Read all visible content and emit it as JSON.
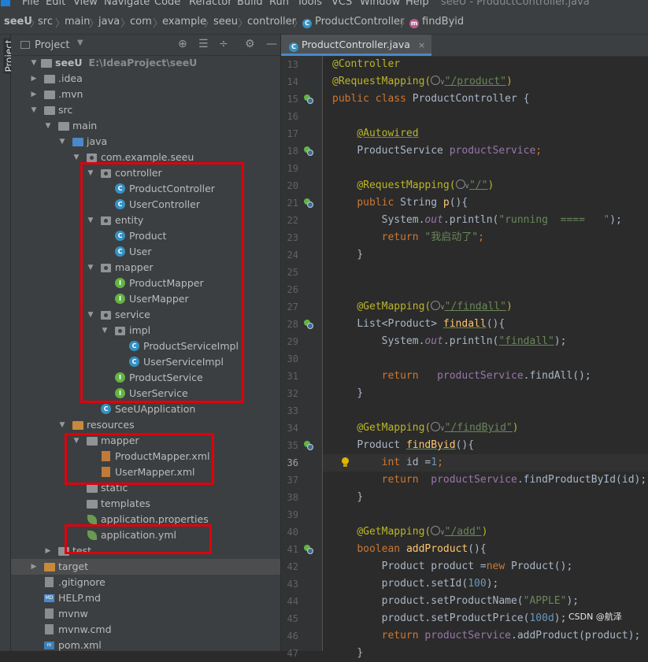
{
  "menu": {
    "items": [
      "File",
      "Edit",
      "View",
      "Navigate",
      "Code",
      "Refactor",
      "Build",
      "Run",
      "Tools",
      "VCS",
      "Window",
      "Help"
    ],
    "window_title": "seeU - ProductController.java"
  },
  "breadcrumb": {
    "items": [
      "seeU",
      "src",
      "main",
      "java",
      "com",
      "example",
      "seeu",
      "controller",
      "ProductController",
      "findByid"
    ]
  },
  "sidebar_strip": {
    "label": "Project"
  },
  "project_panel": {
    "title": "Project",
    "toolbar_icons": [
      "crosshair-icon",
      "collapse-icon",
      "expand-icon",
      "gear-icon",
      "minimize-icon"
    ],
    "tree": [
      {
        "label": "seeU",
        "path": "E:\\IdeaProject\\seeU",
        "type": "module"
      },
      {
        "label": ".idea",
        "type": "folder"
      },
      {
        "label": ".mvn",
        "type": "folder"
      },
      {
        "label": "src",
        "type": "folder"
      },
      {
        "label": "main",
        "type": "folder"
      },
      {
        "label": "java",
        "type": "folder"
      },
      {
        "label": "com.example.seeu",
        "type": "package"
      },
      {
        "label": "controller",
        "type": "package"
      },
      {
        "label": "ProductController",
        "type": "class"
      },
      {
        "label": "UserController",
        "type": "class"
      },
      {
        "label": "entity",
        "type": "package"
      },
      {
        "label": "Product",
        "type": "class"
      },
      {
        "label": "User",
        "type": "class"
      },
      {
        "label": "mapper",
        "type": "package"
      },
      {
        "label": "ProductMapper",
        "type": "interface"
      },
      {
        "label": "UserMapper",
        "type": "interface"
      },
      {
        "label": "service",
        "type": "package"
      },
      {
        "label": "impl",
        "type": "package"
      },
      {
        "label": "ProductServiceImpl",
        "type": "class"
      },
      {
        "label": "UserServiceImpl",
        "type": "class"
      },
      {
        "label": "ProductService",
        "type": "interface"
      },
      {
        "label": "UserService",
        "type": "interface"
      },
      {
        "label": "SeeUApplication",
        "type": "class"
      },
      {
        "label": "resources",
        "type": "folder"
      },
      {
        "label": "mapper",
        "type": "folder"
      },
      {
        "label": "ProductMapper.xml",
        "type": "xml"
      },
      {
        "label": "UserMapper.xml",
        "type": "xml"
      },
      {
        "label": "static",
        "type": "folder"
      },
      {
        "label": "templates",
        "type": "folder"
      },
      {
        "label": "application.properties",
        "type": "spring"
      },
      {
        "label": "application.yml",
        "type": "spring"
      },
      {
        "label": "test",
        "type": "folder"
      },
      {
        "label": "target",
        "type": "folder"
      },
      {
        "label": ".gitignore",
        "type": "file"
      },
      {
        "label": "HELP.md",
        "type": "md"
      },
      {
        "label": "mvnw",
        "type": "file"
      },
      {
        "label": "mvnw.cmd",
        "type": "file"
      },
      {
        "label": "pom.xml",
        "type": "maven"
      }
    ]
  },
  "editor": {
    "tab_label": "ProductController.java",
    "current_line": "36",
    "line_numbers": [
      "13",
      "14",
      "15",
      "16",
      "17",
      "18",
      "19",
      "20",
      "21",
      "22",
      "23",
      "24",
      "25",
      "26",
      "27",
      "28",
      "29",
      "30",
      "31",
      "32",
      "33",
      "34",
      "35",
      "36",
      "37",
      "38",
      "39",
      "40",
      "41",
      "42",
      "43",
      "44",
      "45",
      "46",
      "47"
    ],
    "tokens": {
      "l13_a": "@Controller",
      "l14_a": "@RequestMapping(",
      "l14_b": "\"/product\"",
      "l14_c": ")",
      "l15_a": "public class ",
      "l15_b": "ProductController {",
      "l17_a": "@Autowired",
      "l18_a": "ProductService ",
      "l18_b": "productService",
      "l18_c": ";",
      "l20_a": "@RequestMapping(",
      "l20_b": "\"/\"",
      "l20_c": ")",
      "l21_a": "public ",
      "l21_b": "String ",
      "l21_c": "p",
      "l21_d": "(){",
      "l22_a": "System.",
      "l22_b": "out",
      "l22_c": ".println(",
      "l22_d": "\"running  ====   \"",
      "l22_e": ");",
      "l23_a": "return ",
      "l23_b": "\"我启动了\"",
      "l23_c": ";",
      "l24_a": "}",
      "l27_a": "@GetMapping(",
      "l27_b": "\"/findall\"",
      "l27_c": ")",
      "l28_a": "List<Product> ",
      "l28_b": "findall",
      "l28_c": "(){",
      "l29_a": "System.",
      "l29_b": "out",
      "l29_c": ".println(",
      "l29_d": "\"findall\"",
      "l29_e": ");",
      "l31_a": "return   ",
      "l31_b": "productService",
      "l31_c": ".findAll();",
      "l32_a": "}",
      "l34_a": "@GetMapping(",
      "l34_b": "\"/findByid\"",
      "l34_c": ")",
      "l35_a": "Product ",
      "l35_b": "findByid",
      "l35_c": "(){",
      "l36_a": "int ",
      "l36_b": "id =",
      "l36_c": "1",
      "l36_d": ";",
      "l37_a": "return  ",
      "l37_b": "productService",
      "l37_c": ".findProductById(id);",
      "l38_a": "}",
      "l40_a": "@GetMapping(",
      "l40_b": "\"/add\"",
      "l40_c": ")",
      "l41_a": "boolean ",
      "l41_b": "addProduct",
      "l41_c": "(){",
      "l42_a": "Product product =",
      "l42_b": "new ",
      "l42_c": "Product();",
      "l43_a": "product.setId(",
      "l43_b": "100",
      "l43_c": ");",
      "l44_a": "product.setProductName(",
      "l44_b": "\"APPLE\"",
      "l44_c": ");",
      "l45_a": "product.setProductPrice(",
      "l45_b": "100d",
      "l45_c": ");",
      "l46_a": "return ",
      "l46_b": "productService",
      "l46_c": ".addProduct(product);",
      "l47_a": "}"
    }
  },
  "watermark": "CSDN @航泽"
}
